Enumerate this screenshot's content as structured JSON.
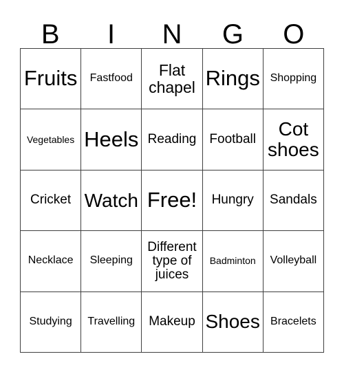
{
  "card": {
    "title": "Bingo Card",
    "header_letters": [
      "B",
      "I",
      "N",
      "G",
      "O"
    ],
    "columns": 5,
    "rows": 5,
    "border_color": "#3f3f3f",
    "background_color": "#ffffff",
    "text_color": "#000000",
    "free_space_label": "Free!",
    "cells": [
      [
        {
          "text": "Fruits",
          "size": "sz-xl"
        },
        {
          "text": "Fastfood",
          "size": "sz-xs"
        },
        {
          "text": "Flat chapel",
          "size": "sz-md"
        },
        {
          "text": "Rings",
          "size": "sz-xl"
        },
        {
          "text": "Shopping",
          "size": "sz-xs"
        }
      ],
      [
        {
          "text": "Vegetables",
          "size": "sz-xxs"
        },
        {
          "text": "Heels",
          "size": "sz-xl"
        },
        {
          "text": "Reading",
          "size": "sz-sm"
        },
        {
          "text": "Football",
          "size": "sz-sm"
        },
        {
          "text": "Cot shoes",
          "size": "sz-lg"
        }
      ],
      [
        {
          "text": "Cricket",
          "size": "sz-sm"
        },
        {
          "text": "Watch",
          "size": "sz-lg"
        },
        {
          "text": "Free!",
          "size": "sz-xl"
        },
        {
          "text": "Hungry",
          "size": "sz-sm"
        },
        {
          "text": "Sandals",
          "size": "sz-sm"
        }
      ],
      [
        {
          "text": "Necklace",
          "size": "sz-xs"
        },
        {
          "text": "Sleeping",
          "size": "sz-xs"
        },
        {
          "text": "Different type of juices",
          "size": "sz-sm"
        },
        {
          "text": "Badminton",
          "size": "sz-xxs"
        },
        {
          "text": "Volleyball",
          "size": "sz-xs"
        }
      ],
      [
        {
          "text": "Studying",
          "size": "sz-xs"
        },
        {
          "text": "Travelling",
          "size": "sz-xs"
        },
        {
          "text": "Makeup",
          "size": "sz-sm"
        },
        {
          "text": "Shoes",
          "size": "sz-lg"
        },
        {
          "text": "Bracelets",
          "size": "sz-xs"
        }
      ]
    ]
  }
}
